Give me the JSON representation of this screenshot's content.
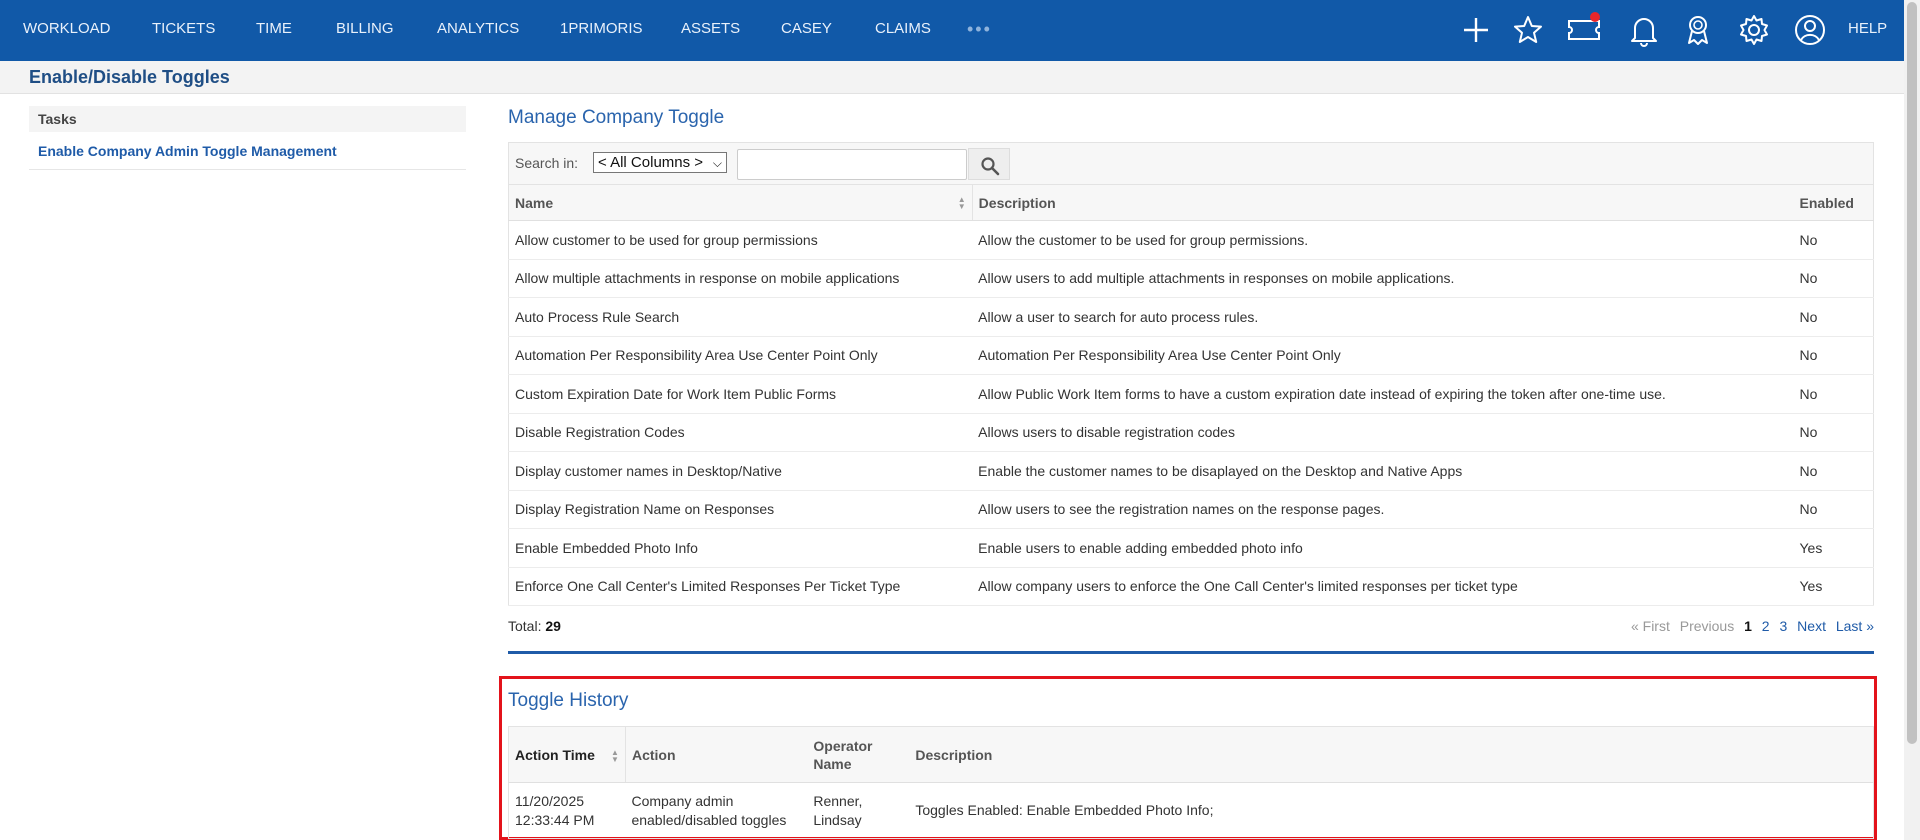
{
  "nav": {
    "items": [
      "WORKLOAD",
      "TICKETS",
      "TIME",
      "BILLING",
      "ANALYTICS",
      "1PRIMORIS",
      "ASSETS",
      "CASEY",
      "CLAIMS"
    ],
    "more": "•••",
    "help": "HELP",
    "icons": [
      "plus-icon",
      "star-icon",
      "ticket-icon",
      "bell-icon",
      "award-icon",
      "gear-icon",
      "user-icon"
    ]
  },
  "page": {
    "title": "Enable/Disable Toggles"
  },
  "tasks": {
    "heading": "Tasks",
    "link": "Enable Company Admin Toggle Management"
  },
  "manage": {
    "title": "Manage Company Toggle",
    "search_label": "Search in:",
    "search_scope": "< All Columns >",
    "search_value": "",
    "columns": [
      "Name",
      "Description",
      "Enabled"
    ],
    "rows": [
      [
        "Allow customer to be used for group permissions",
        "Allow the customer to be used for group permissions.",
        "No"
      ],
      [
        "Allow multiple attachments in response on mobile applications",
        "Allow users to add multiple attachments in responses on mobile applications.",
        "No"
      ],
      [
        "Auto Process Rule Search",
        "Allow a user to search for auto process rules.",
        "No"
      ],
      [
        "Automation Per Responsibility Area Use Center Point Only",
        "Automation Per Responsibility Area Use Center Point Only",
        "No"
      ],
      [
        "Custom Expiration Date for Work Item Public Forms",
        "Allow Public Work Item forms to have a custom expiration date instead of expiring the token after one-time use.",
        "No"
      ],
      [
        "Disable Registration Codes",
        "Allows users to disable registration codes",
        "No"
      ],
      [
        "Display customer names in Desktop/Native",
        "Enable the customer names to be disaplayed on the Desktop and Native Apps",
        "No"
      ],
      [
        "Display Registration Name on Responses",
        "Allow users to see the registration names on the response pages.",
        "No"
      ],
      [
        "Enable Embedded Photo Info",
        "Enable users to enable adding embedded photo info",
        "Yes"
      ],
      [
        "Enforce One Call Center's Limited Responses Per Ticket Type",
        "Allow company users to enforce the One Call Center's limited responses per ticket type",
        "Yes"
      ]
    ],
    "total_label": "Total:",
    "total_value": "29",
    "pager": {
      "first": "« First",
      "previous": "Previous",
      "pages": [
        "1",
        "2",
        "3"
      ],
      "current": "1",
      "next": "Next",
      "last": "Last »"
    }
  },
  "history": {
    "title": "Toggle History",
    "columns": [
      "Action Time",
      "Action",
      "Operator Name",
      "Description"
    ],
    "rows": [
      [
        "11/20/2025 12:33:44 PM",
        "Company admin enabled/disabled toggles",
        "Renner, Lindsay",
        "Toggles Enabled: Enable Embedded Photo Info;"
      ]
    ]
  }
}
